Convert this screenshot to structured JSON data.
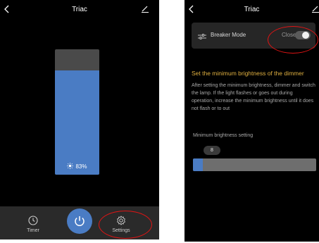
{
  "left_screen": {
    "title": "Triac",
    "brightness": {
      "percent": 83,
      "label": "83%"
    },
    "tabs": {
      "timer_label": "Timer",
      "settings_label": "Settings"
    }
  },
  "right_screen": {
    "title": "Triac",
    "breaker_mode": {
      "label": "Breaker Mode",
      "state_text": "Close",
      "enabled": false
    },
    "heading": "Set the minimum brightness of the dimmer",
    "description": "After setting the minimum brightness, dimmer and switch the lamp. If the light flashes or goes out during operation, increase the minimum brightness until it does not flash or to out",
    "min_brightness": {
      "label": "Minimum brightness setting",
      "value_text": "8",
      "value": 8
    }
  },
  "colors": {
    "accent_blue": "#4a7cc4",
    "heading_gold": "#e0b040",
    "annotation_red": "#e01414"
  },
  "icons": [
    "back-icon",
    "edit-icon",
    "sun-icon",
    "clock-icon",
    "power-icon",
    "gear-icon",
    "sliders-icon"
  ]
}
